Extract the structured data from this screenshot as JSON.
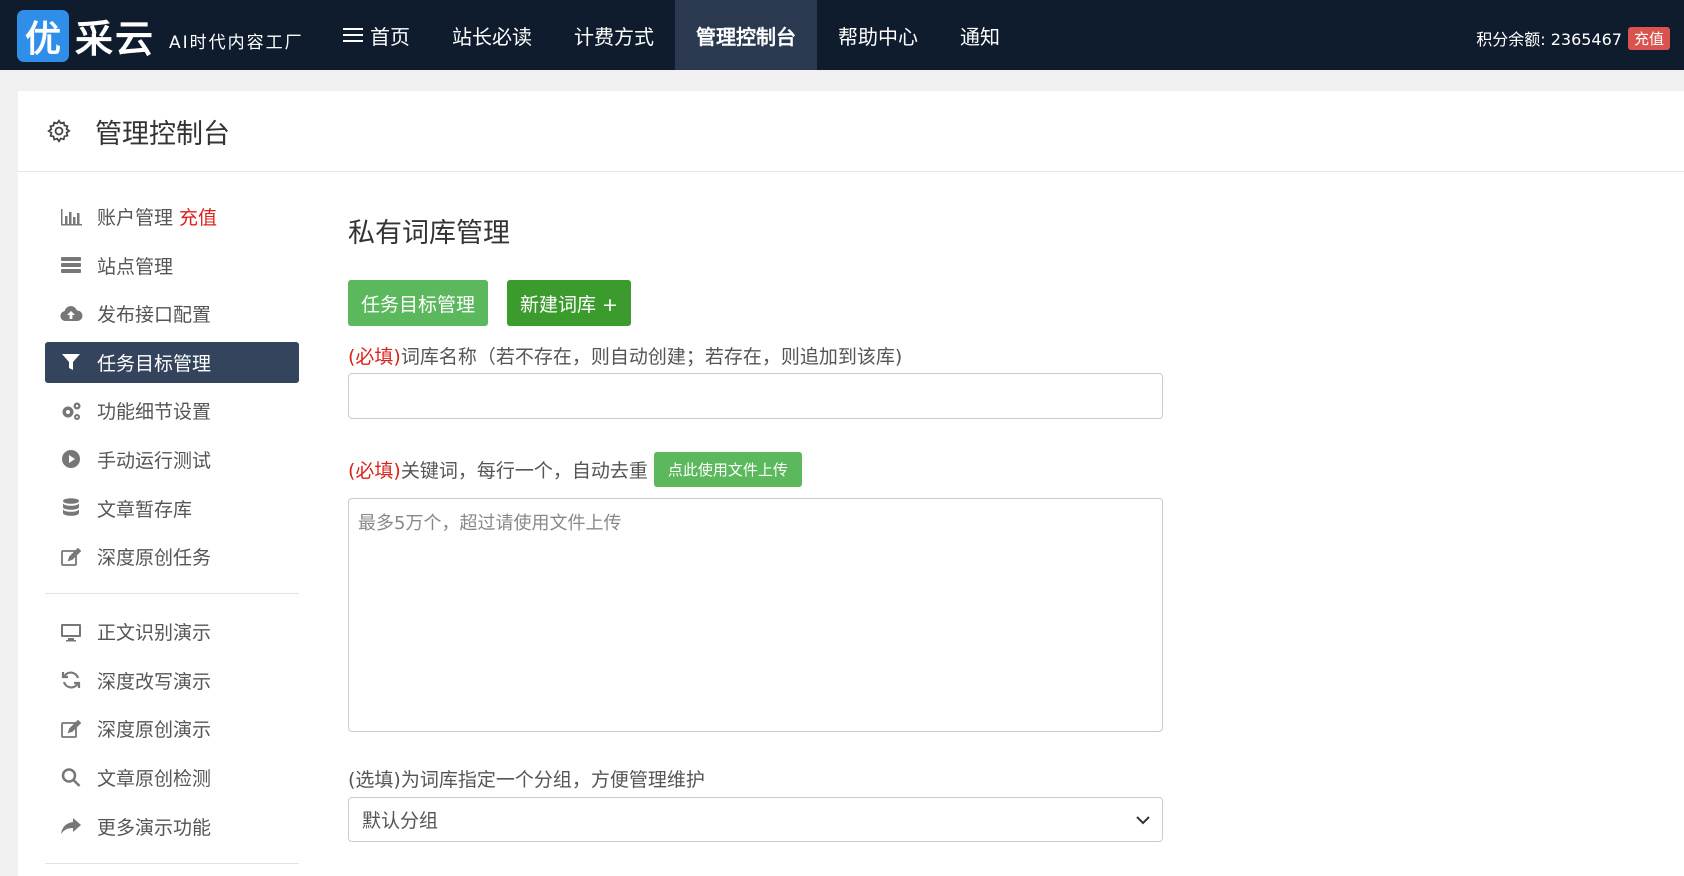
{
  "brand": {
    "badge": "优",
    "name": "采云",
    "slogan": "AI时代内容工厂"
  },
  "nav": {
    "items": [
      "首页",
      "站长必读",
      "计费方式",
      "管理控制台",
      "帮助中心",
      "通知"
    ],
    "points_label": "积分余额: 2365467",
    "recharge_label": "充值"
  },
  "panel": {
    "title": "管理控制台"
  },
  "sidebar": {
    "items": [
      {
        "label": "账户管理",
        "extra": "充值",
        "icon": "bar-chart-icon"
      },
      {
        "label": "站点管理",
        "icon": "server-icon"
      },
      {
        "label": "发布接口配置",
        "icon": "cloud-upload-icon"
      },
      {
        "label": "任务目标管理",
        "icon": "filter-icon",
        "active": true
      },
      {
        "label": "功能细节设置",
        "icon": "cogs-icon"
      },
      {
        "label": "手动运行测试",
        "icon": "play-circle-icon"
      },
      {
        "label": "文章暂存库",
        "icon": "database-icon"
      },
      {
        "label": "深度原创任务",
        "icon": "edit-icon"
      }
    ],
    "demo_items": [
      {
        "label": "正文识别演示",
        "icon": "monitor-icon"
      },
      {
        "label": "深度改写演示",
        "icon": "refresh-icon"
      },
      {
        "label": "深度原创演示",
        "icon": "edit-icon"
      },
      {
        "label": "文章原创检测",
        "icon": "search-icon"
      },
      {
        "label": "更多演示功能",
        "icon": "share-icon"
      }
    ]
  },
  "main": {
    "title": "私有词库管理",
    "btn_task": "任务目标管理",
    "btn_new": "新建词库 +",
    "name_required": "(必填)",
    "name_label": "词库名称（若不存在，则自动创建；若存在，则追加到该库)",
    "name_value": "",
    "kw_required": "(必填)",
    "kw_label": "关键词，每行一个，自动去重",
    "upload_label": "点此使用文件上传",
    "kw_placeholder": "最多5万个，超过请使用文件上传",
    "group_label": "(选填)为词库指定一个分组，方便管理维护",
    "group_value": "默认分组"
  },
  "colors": {
    "nav_bg": "#0f1c2e",
    "active_nav": "#2a3950",
    "sidebar_active": "#34445c",
    "green": "#5cb85c",
    "dark_green": "#3c9b2d",
    "required_red": "#d9231e"
  }
}
